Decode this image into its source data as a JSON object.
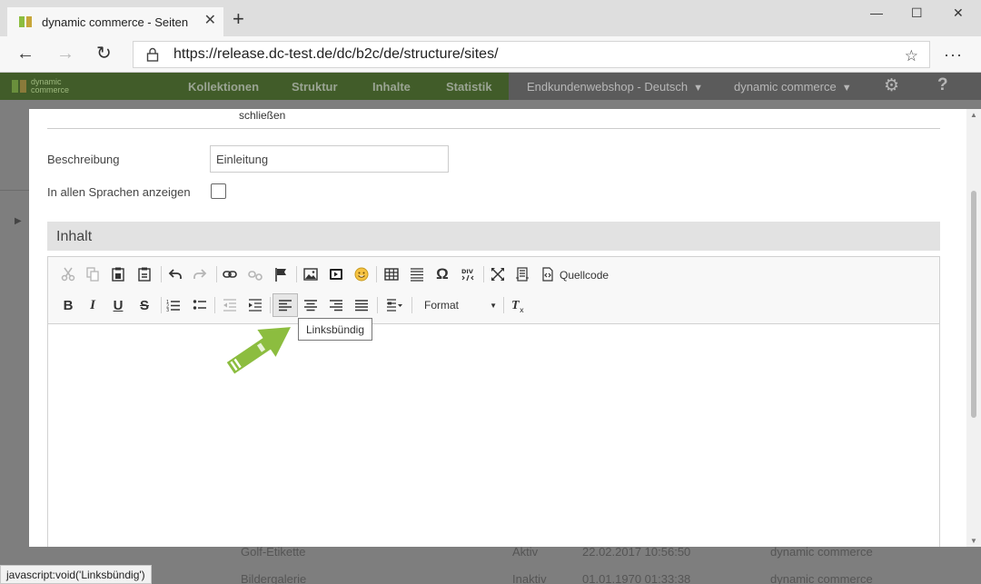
{
  "browser": {
    "tab_title": "dynamic commerce - Seiten",
    "tab_close": "✕",
    "new_tab": "+",
    "url": "https://release.dc-test.de/dc/b2c/de/structure/sites/",
    "status_text": "javascript:void('Linksbündig')",
    "window_min": "—",
    "window_max": "☐",
    "window_close": "✕",
    "back": "←",
    "forward": "→",
    "reload": "↻",
    "favorite": "☆",
    "more": "···"
  },
  "app": {
    "logo_line1": "dynamic",
    "logo_line2": "commerce",
    "nav": [
      "Kollektionen",
      "Struktur",
      "Inhalte",
      "Statistik"
    ],
    "shop_select": "Endkundenwebshop - Deutsch",
    "user_select": "dynamic commerce",
    "gear": "⚙",
    "help": "?",
    "colors": {
      "brand": "#8cbd3f",
      "tooltip_arrow": "#8cbd3f"
    }
  },
  "background_table": {
    "rows": [
      {
        "name": "Golf-Etikette",
        "status": "Aktiv",
        "date": "22.02.2017 10:56:50",
        "owner": "dynamic commerce"
      },
      {
        "name": "Bildergalerie",
        "status": "Inaktiv",
        "date": "01.01.1970 01:33:38",
        "owner": "dynamic commerce"
      }
    ]
  },
  "modal": {
    "prev_label": "schließen",
    "description_label": "Beschreibung",
    "description_value": "Einleitung",
    "all_languages_label": "In allen Sprachen anzeigen",
    "content_section": "Inhalt",
    "editor": {
      "source_label": "Quellcode",
      "format_label": "Format",
      "tooltip": "Linksbündig",
      "bold": "B",
      "italic": "I",
      "underline": "U",
      "strike": "S",
      "omega": "Ω"
    }
  }
}
